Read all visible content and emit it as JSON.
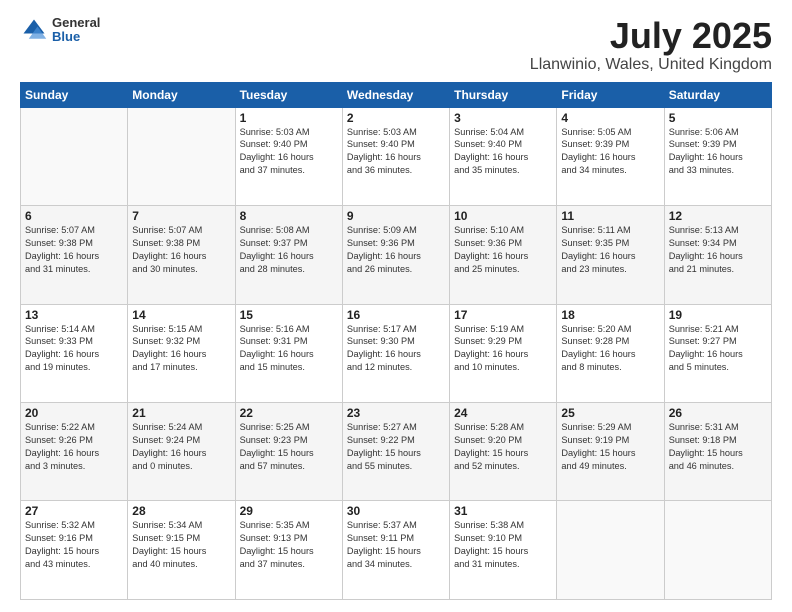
{
  "logo": {
    "general": "General",
    "blue": "Blue"
  },
  "header": {
    "title": "July 2025",
    "subtitle": "Llanwinio, Wales, United Kingdom"
  },
  "weekdays": [
    "Sunday",
    "Monday",
    "Tuesday",
    "Wednesday",
    "Thursday",
    "Friday",
    "Saturday"
  ],
  "weeks": [
    [
      {
        "day": "",
        "info": ""
      },
      {
        "day": "",
        "info": ""
      },
      {
        "day": "1",
        "info": "Sunrise: 5:03 AM\nSunset: 9:40 PM\nDaylight: 16 hours\nand 37 minutes."
      },
      {
        "day": "2",
        "info": "Sunrise: 5:03 AM\nSunset: 9:40 PM\nDaylight: 16 hours\nand 36 minutes."
      },
      {
        "day": "3",
        "info": "Sunrise: 5:04 AM\nSunset: 9:40 PM\nDaylight: 16 hours\nand 35 minutes."
      },
      {
        "day": "4",
        "info": "Sunrise: 5:05 AM\nSunset: 9:39 PM\nDaylight: 16 hours\nand 34 minutes."
      },
      {
        "day": "5",
        "info": "Sunrise: 5:06 AM\nSunset: 9:39 PM\nDaylight: 16 hours\nand 33 minutes."
      }
    ],
    [
      {
        "day": "6",
        "info": "Sunrise: 5:07 AM\nSunset: 9:38 PM\nDaylight: 16 hours\nand 31 minutes."
      },
      {
        "day": "7",
        "info": "Sunrise: 5:07 AM\nSunset: 9:38 PM\nDaylight: 16 hours\nand 30 minutes."
      },
      {
        "day": "8",
        "info": "Sunrise: 5:08 AM\nSunset: 9:37 PM\nDaylight: 16 hours\nand 28 minutes."
      },
      {
        "day": "9",
        "info": "Sunrise: 5:09 AM\nSunset: 9:36 PM\nDaylight: 16 hours\nand 26 minutes."
      },
      {
        "day": "10",
        "info": "Sunrise: 5:10 AM\nSunset: 9:36 PM\nDaylight: 16 hours\nand 25 minutes."
      },
      {
        "day": "11",
        "info": "Sunrise: 5:11 AM\nSunset: 9:35 PM\nDaylight: 16 hours\nand 23 minutes."
      },
      {
        "day": "12",
        "info": "Sunrise: 5:13 AM\nSunset: 9:34 PM\nDaylight: 16 hours\nand 21 minutes."
      }
    ],
    [
      {
        "day": "13",
        "info": "Sunrise: 5:14 AM\nSunset: 9:33 PM\nDaylight: 16 hours\nand 19 minutes."
      },
      {
        "day": "14",
        "info": "Sunrise: 5:15 AM\nSunset: 9:32 PM\nDaylight: 16 hours\nand 17 minutes."
      },
      {
        "day": "15",
        "info": "Sunrise: 5:16 AM\nSunset: 9:31 PM\nDaylight: 16 hours\nand 15 minutes."
      },
      {
        "day": "16",
        "info": "Sunrise: 5:17 AM\nSunset: 9:30 PM\nDaylight: 16 hours\nand 12 minutes."
      },
      {
        "day": "17",
        "info": "Sunrise: 5:19 AM\nSunset: 9:29 PM\nDaylight: 16 hours\nand 10 minutes."
      },
      {
        "day": "18",
        "info": "Sunrise: 5:20 AM\nSunset: 9:28 PM\nDaylight: 16 hours\nand 8 minutes."
      },
      {
        "day": "19",
        "info": "Sunrise: 5:21 AM\nSunset: 9:27 PM\nDaylight: 16 hours\nand 5 minutes."
      }
    ],
    [
      {
        "day": "20",
        "info": "Sunrise: 5:22 AM\nSunset: 9:26 PM\nDaylight: 16 hours\nand 3 minutes."
      },
      {
        "day": "21",
        "info": "Sunrise: 5:24 AM\nSunset: 9:24 PM\nDaylight: 16 hours\nand 0 minutes."
      },
      {
        "day": "22",
        "info": "Sunrise: 5:25 AM\nSunset: 9:23 PM\nDaylight: 15 hours\nand 57 minutes."
      },
      {
        "day": "23",
        "info": "Sunrise: 5:27 AM\nSunset: 9:22 PM\nDaylight: 15 hours\nand 55 minutes."
      },
      {
        "day": "24",
        "info": "Sunrise: 5:28 AM\nSunset: 9:20 PM\nDaylight: 15 hours\nand 52 minutes."
      },
      {
        "day": "25",
        "info": "Sunrise: 5:29 AM\nSunset: 9:19 PM\nDaylight: 15 hours\nand 49 minutes."
      },
      {
        "day": "26",
        "info": "Sunrise: 5:31 AM\nSunset: 9:18 PM\nDaylight: 15 hours\nand 46 minutes."
      }
    ],
    [
      {
        "day": "27",
        "info": "Sunrise: 5:32 AM\nSunset: 9:16 PM\nDaylight: 15 hours\nand 43 minutes."
      },
      {
        "day": "28",
        "info": "Sunrise: 5:34 AM\nSunset: 9:15 PM\nDaylight: 15 hours\nand 40 minutes."
      },
      {
        "day": "29",
        "info": "Sunrise: 5:35 AM\nSunset: 9:13 PM\nDaylight: 15 hours\nand 37 minutes."
      },
      {
        "day": "30",
        "info": "Sunrise: 5:37 AM\nSunset: 9:11 PM\nDaylight: 15 hours\nand 34 minutes."
      },
      {
        "day": "31",
        "info": "Sunrise: 5:38 AM\nSunset: 9:10 PM\nDaylight: 15 hours\nand 31 minutes."
      },
      {
        "day": "",
        "info": ""
      },
      {
        "day": "",
        "info": ""
      }
    ]
  ]
}
